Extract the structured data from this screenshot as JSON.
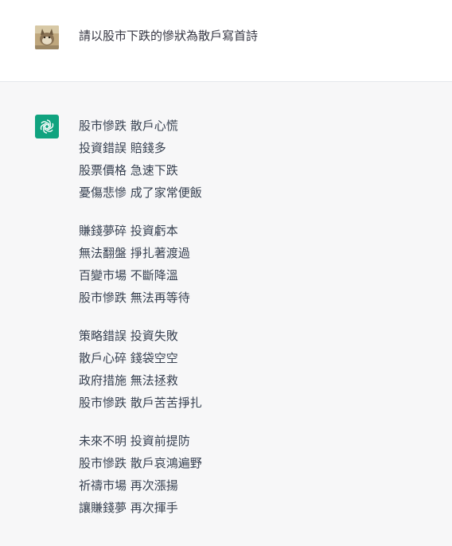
{
  "user_message": {
    "avatar_icon": "user-avatar-cat-photo",
    "text": "請以股市下跌的慘狀為散戶寫首詩"
  },
  "assistant_message": {
    "avatar_icon": "chatgpt-logo-icon",
    "accent_color": "#10a37f",
    "stanzas": [
      {
        "lines": [
          "股市慘跌 散戶心慌",
          "投資錯誤 賠錢多",
          "股票價格 急速下跌",
          "憂傷悲慘 成了家常便飯"
        ]
      },
      {
        "lines": [
          "賺錢夢碎 投資虧本",
          "無法翻盤 掙扎著渡過",
          "百變市場 不斷降溫",
          "股市慘跌 無法再等待"
        ]
      },
      {
        "lines": [
          "策略錯誤 投資失敗",
          "散戶心碎 錢袋空空",
          "政府措施 無法拯救",
          "股市慘跌 散戶苦苦掙扎"
        ]
      },
      {
        "lines": [
          "未來不明 投資前提防",
          "股市慘跌 散戶哀鴻遍野",
          "祈禱市場 再次漲揚",
          "讓賺錢夢 再次揮手"
        ]
      }
    ]
  }
}
